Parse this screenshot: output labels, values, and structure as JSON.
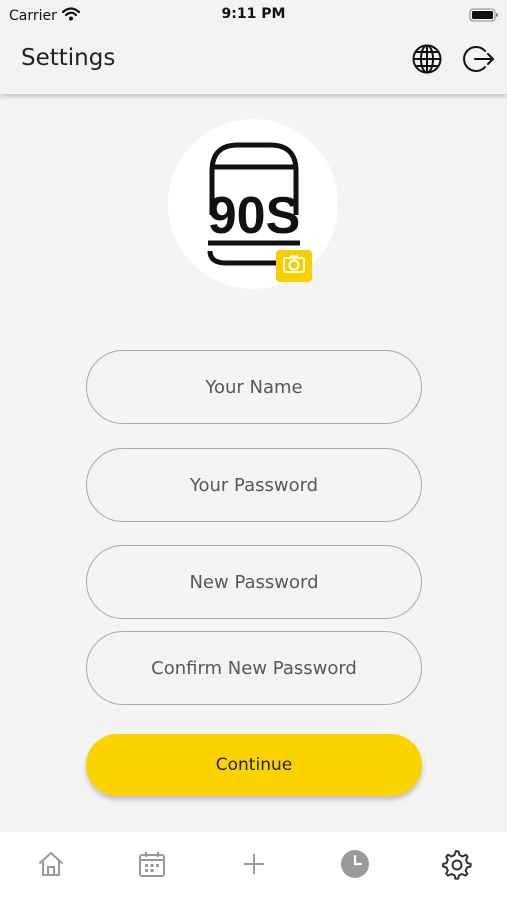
{
  "status_bar": {
    "carrier": "Carrier",
    "time": "9:11 PM"
  },
  "header": {
    "title": "Settings",
    "globe_icon": "globe-icon",
    "logout_icon": "logout-icon"
  },
  "avatar": {
    "logo_text": "90S",
    "badge_icon": "camera-icon",
    "badge_color": "#f8d000"
  },
  "form": {
    "name_placeholder": "Your Name",
    "password_placeholder": "Your Password",
    "new_password_placeholder": "New Password",
    "confirm_password_placeholder": "Confirm New Password",
    "continue_label": "Continue"
  },
  "tabbar": {
    "items": [
      {
        "icon": "home-icon",
        "active": false
      },
      {
        "icon": "calendar-icon",
        "active": false
      },
      {
        "icon": "plus-icon",
        "active": false
      },
      {
        "icon": "clock-icon",
        "active": false
      },
      {
        "icon": "gear-icon",
        "active": true
      }
    ]
  },
  "colors": {
    "accent": "#fbd400",
    "background": "#f4f4f4",
    "tab_inactive": "#9a9a9a",
    "tab_active": "#333333"
  }
}
